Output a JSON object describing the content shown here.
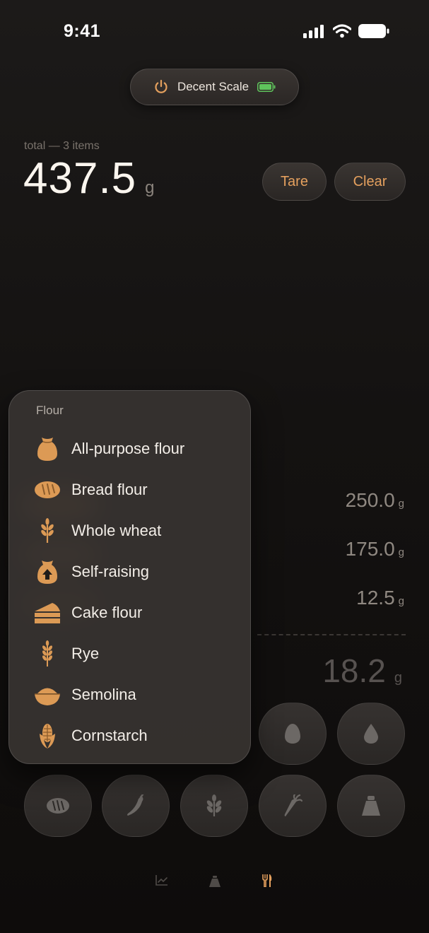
{
  "status_bar": {
    "time": "9:41"
  },
  "device": {
    "name": "Decent Scale",
    "icon": "power-icon",
    "battery_color": "#5fc35c"
  },
  "total": {
    "caption": "total — 3 items",
    "value": "437.5",
    "unit": "g"
  },
  "actions": {
    "tare_label": "Tare",
    "clear_label": "Clear"
  },
  "items": [
    {
      "value": "250.0",
      "unit": "g"
    },
    {
      "value": "175.0",
      "unit": "g"
    },
    {
      "value": "12.5",
      "unit": "g"
    }
  ],
  "live": {
    "value": "18.2",
    "unit": "g"
  },
  "menu": {
    "title": "Flour",
    "items": [
      {
        "label": "All-purpose flour",
        "icon": "flour-bag-icon"
      },
      {
        "label": "Bread flour",
        "icon": "bread-loaf-icon"
      },
      {
        "label": "Whole wheat",
        "icon": "wheat-icon"
      },
      {
        "label": "Self-raising",
        "icon": "self-raising-bag-icon"
      },
      {
        "label": "Cake flour",
        "icon": "cake-slice-icon"
      },
      {
        "label": "Rye",
        "icon": "rye-icon"
      },
      {
        "label": "Semolina",
        "icon": "semolina-bowl-icon"
      },
      {
        "label": "Cornstarch",
        "icon": "corn-icon"
      }
    ]
  },
  "category_buttons": [
    "egg-icon",
    "water-drop-icon",
    "bread-icon",
    "chili-icon",
    "wheat-icon",
    "carrot-icon",
    "weight-icon"
  ],
  "tab_bar": [
    "chart-tab-icon",
    "scale-tab-icon",
    "utensils-tab-icon"
  ],
  "colors": {
    "accent": "#e4a05e",
    "icon_fill": "#dc9a55"
  }
}
